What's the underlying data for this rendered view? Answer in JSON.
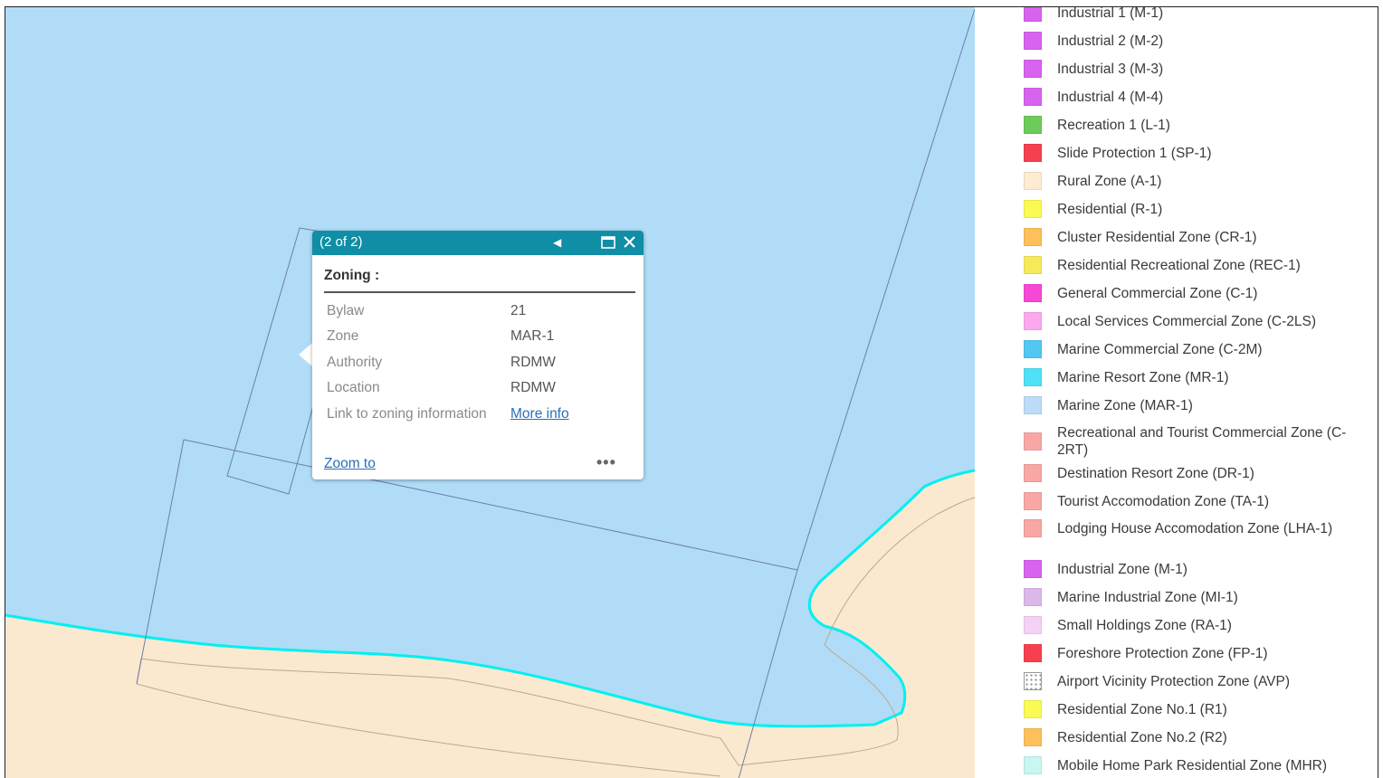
{
  "popup": {
    "count": "(2 of 2)",
    "title": "Zoning :",
    "attributes": [
      {
        "label": "Bylaw",
        "value": "21"
      },
      {
        "label": "Zone",
        "value": "MAR-1"
      },
      {
        "label": "Authority",
        "value": "RDMW"
      },
      {
        "label": "Location",
        "value": "RDMW"
      },
      {
        "label": "Link to zoning information",
        "value": "More info"
      }
    ],
    "zoom_to": "Zoom to",
    "more_menu": "•••",
    "icons": {
      "prev": "◀",
      "maximize": "□",
      "close": "✕"
    }
  },
  "map": {
    "water_color": "#b0dcf7",
    "land_color": "#fbe9cf",
    "shoreline_color": "#00f0f0",
    "parcel_line_color": "#6c7fa8"
  },
  "legend": {
    "items": [
      {
        "label": "Industrial 1 (M-1)",
        "color": "#d863ef"
      },
      {
        "label": "Industrial 2 (M-2)",
        "color": "#d863ef"
      },
      {
        "label": "Industrial 3 (M-3)",
        "color": "#d863ef"
      },
      {
        "label": "Industrial 4 (M-4)",
        "color": "#d863ef"
      },
      {
        "label": "Recreation 1 (L-1)",
        "color": "#6ccb5a"
      },
      {
        "label": "Slide Protection 1 (SP-1)",
        "color": "#f7404f"
      },
      {
        "label": "Rural Zone (A-1)",
        "color": "#fdecd2"
      },
      {
        "label": "Residential (R-1)",
        "color": "#fafa52"
      },
      {
        "label": "Cluster Residential Zone (CR-1)",
        "color": "#fdc05a"
      },
      {
        "label": "Residential Recreational Zone (REC-1)",
        "color": "#f6ea5c"
      },
      {
        "label": "General Commercial Zone (C-1)",
        "color": "#f549d6"
      },
      {
        "label": "Local Services Commercial Zone (C-2LS)",
        "color": "#fba8ef"
      },
      {
        "label": "Marine Commercial Zone (C-2M)",
        "color": "#50c8f2"
      },
      {
        "label": "Marine Resort Zone (MR-1)",
        "color": "#4fe1f7"
      },
      {
        "label": "Marine Zone (MAR-1)",
        "color": "#bcdcf7"
      },
      {
        "label": "Recreational and Tourist Commercial Zone (C-2RT)",
        "color": "#f8a7a5"
      },
      {
        "label": "Destination Resort Zone (DR-1)",
        "color": "#f8a7a5"
      },
      {
        "label": "Tourist Accomodation Zone (TA-1)",
        "color": "#f8a7a5"
      },
      {
        "label": "Lodging House Accomodation Zone (LHA-1)",
        "color": "#f8a7a5"
      },
      {
        "label": "Industrial Zone (M-1)",
        "color": "#d863ef"
      },
      {
        "label": "Marine Industrial Zone (MI-1)",
        "color": "#dcb8ea"
      },
      {
        "label": "Small Holdings Zone (RA-1)",
        "color": "#f4d2f6"
      },
      {
        "label": "Foreshore Protection Zone (FP-1)",
        "color": "#f7404f"
      },
      {
        "label": "Airport Vicinity Protection Zone (AVP)",
        "color": "#ffffff",
        "pattern": "dotted"
      },
      {
        "label": "Residential Zone No.1 (R1)",
        "color": "#fafa52"
      },
      {
        "label": "Residential Zone No.2 (R2)",
        "color": "#fdc05a"
      },
      {
        "label": "Mobile Home Park Residential Zone (MHR)",
        "color": "#c8f7f2"
      }
    ]
  }
}
